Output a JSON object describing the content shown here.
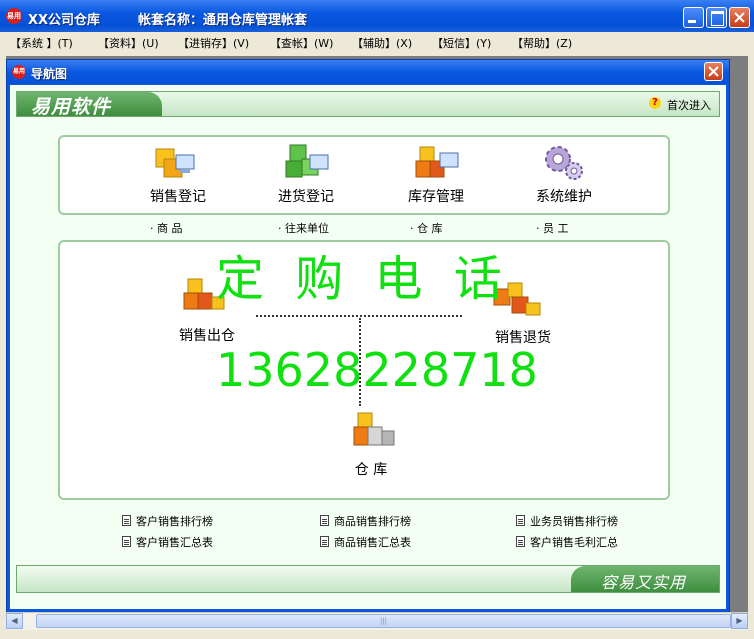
{
  "window": {
    "title": "XX公司仓库",
    "account_label": "帐套名称：通用仓库管理帐套",
    "app_icon": "易用"
  },
  "menu": [
    "【系统 】(T)",
    "【资料】(U)",
    "【进销存】(V)",
    "【查帐】(W)",
    "【辅助】(X)",
    "【短信】(Y)",
    "【帮助】(Z)"
  ],
  "child": {
    "title": "导航图",
    "brand": "易用软件",
    "first_enter": "首次进入",
    "slogan": "容易又实用"
  },
  "modules": [
    {
      "label": "销售登记",
      "sub": "· 商  品"
    },
    {
      "label": "进货登记",
      "sub": "· 往来单位"
    },
    {
      "label": "库存管理",
      "sub": "· 仓  库"
    },
    {
      "label": "系统维护",
      "sub": "· 员  工"
    }
  ],
  "flow": {
    "sales_out": "销售出仓",
    "sales_return": "销售退货",
    "warehouse": "仓  库"
  },
  "watermark": {
    "title": "定 购 电 话",
    "phone": "13628228718"
  },
  "reports": [
    "客户销售排行榜",
    "商品销售排行榜",
    "业务员销售排行榜",
    "客户销售汇总表",
    "商品销售汇总表",
    "客户销售毛利汇总"
  ],
  "scroll_thumb_glyph": "|||",
  "colors": {
    "titlebar": "#0a58e0",
    "watermark": "#10e010",
    "panel_border": "#9fcb9f"
  }
}
